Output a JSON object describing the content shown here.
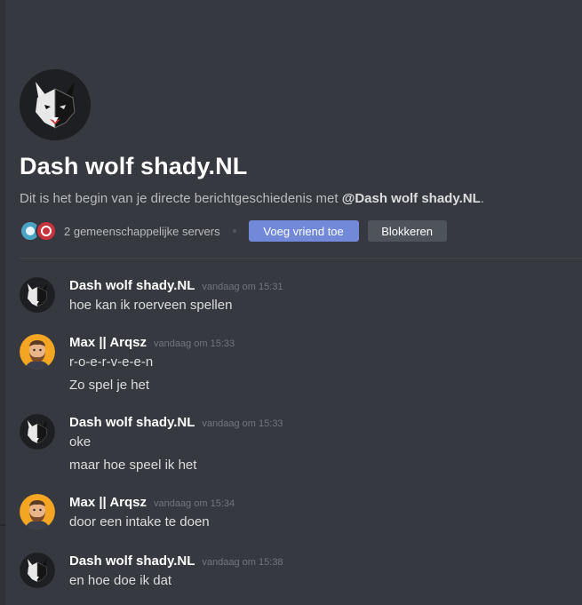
{
  "header": {
    "name": "Dash wolf shady.NL",
    "intro_prefix": "Dit is het begin van je directe berichtgeschiedenis met ",
    "intro_mention": "@Dash wolf shady.NL",
    "intro_suffix": ".",
    "mutual_servers": "2 gemeenschappelijke servers",
    "add_friend_label": "Voeg vriend toe",
    "block_label": "Blokkeren"
  },
  "messages": [
    {
      "author": "Dash wolf shady.NL",
      "avatar": "wolf-avatar",
      "timestamp": "vandaag om 15:31",
      "lines": [
        "hoe kan ik roerveen spellen"
      ]
    },
    {
      "author": "Max || Arqsz",
      "avatar": "bearded-man-avatar",
      "timestamp": "vandaag om 15:33",
      "lines": [
        "r-o-e-r-v-e-e-n",
        "Zo spel je het"
      ]
    },
    {
      "author": "Dash wolf shady.NL",
      "avatar": "wolf-avatar",
      "timestamp": "vandaag om 15:33",
      "lines": [
        "oke",
        "maar hoe speel ik het"
      ]
    },
    {
      "author": "Max || Arqsz",
      "avatar": "bearded-man-avatar",
      "timestamp": "vandaag om 15:34",
      "lines": [
        "door een intake te doen"
      ]
    },
    {
      "author": "Dash wolf shady.NL",
      "avatar": "wolf-avatar",
      "timestamp": "vandaag om 15:38",
      "lines": [
        "en hoe doe ik dat"
      ]
    }
  ],
  "colors": {
    "background": "#36393f",
    "primary_button": "#7289da",
    "secondary_button": "#4f545c",
    "timestamp": "#72767d",
    "max_avatar_bg": "#f4a623"
  }
}
